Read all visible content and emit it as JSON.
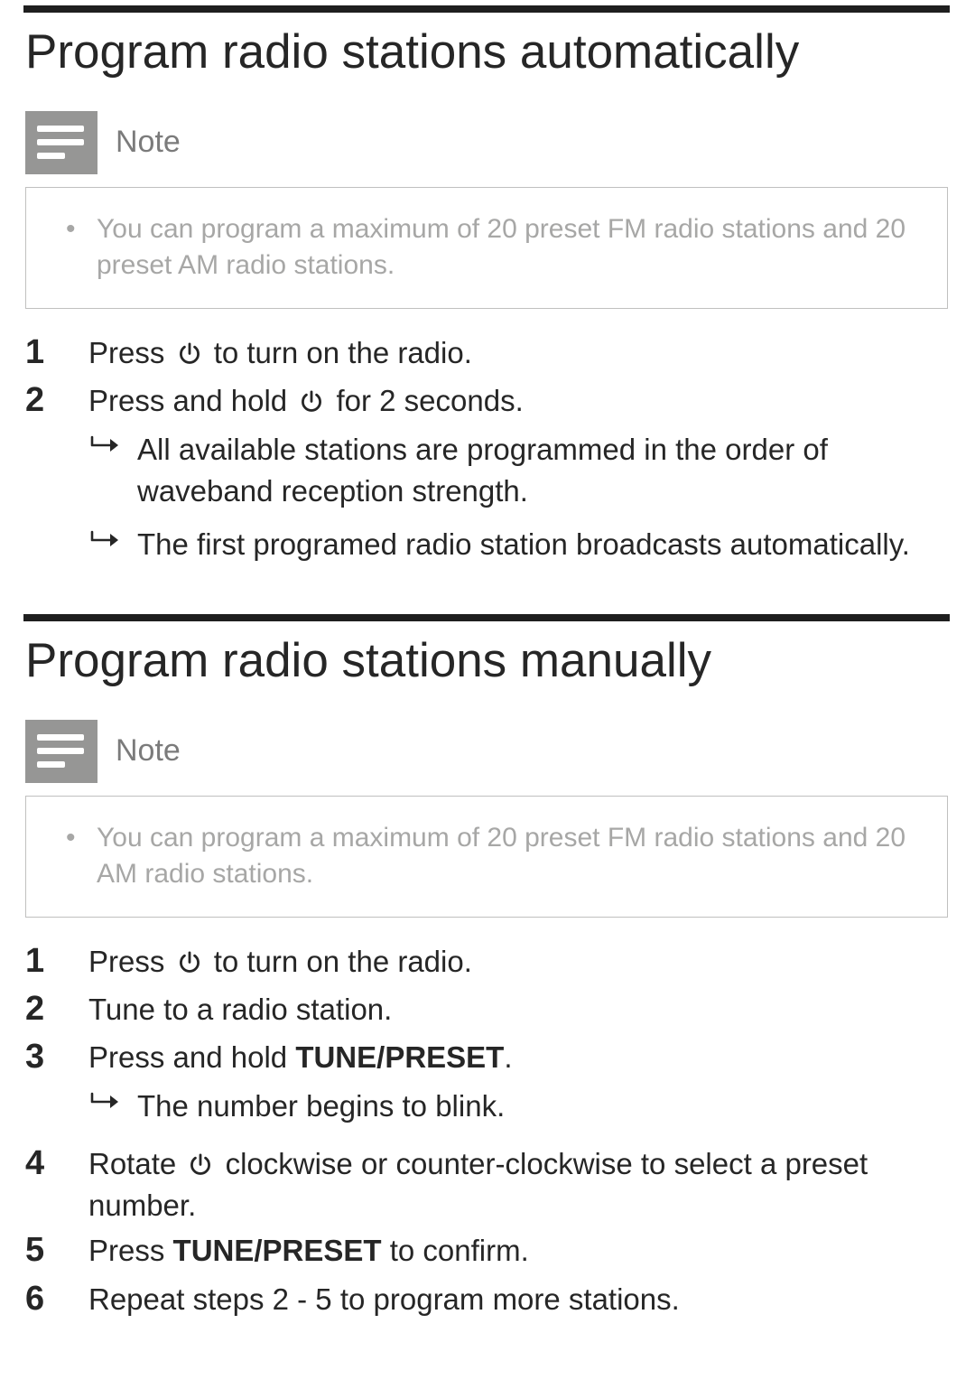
{
  "sections": [
    {
      "heading": "Program radio stations automatically",
      "note": {
        "label": "Note",
        "items": [
          "You can program a maximum of 20 preset FM radio stations and 20 preset AM radio stations."
        ]
      },
      "steps": [
        {
          "parts": [
            {
              "t": "text",
              "v": "Press "
            },
            {
              "t": "power"
            },
            {
              "t": "text",
              "v": " to turn on the radio."
            }
          ]
        },
        {
          "parts": [
            {
              "t": "text",
              "v": "Press and hold "
            },
            {
              "t": "power"
            },
            {
              "t": "text",
              "v": " for 2 seconds."
            }
          ],
          "sub": [
            "All available stations are programmed in the order of waveband reception strength.",
            "The first programed radio station broadcasts automatically."
          ]
        }
      ]
    },
    {
      "heading": "Program radio stations manually",
      "note": {
        "label": "Note",
        "items": [
          "You can program a maximum of 20 preset FM radio stations and 20 AM radio stations."
        ]
      },
      "steps": [
        {
          "parts": [
            {
              "t": "text",
              "v": "Press "
            },
            {
              "t": "power"
            },
            {
              "t": "text",
              "v": " to turn on the radio."
            }
          ]
        },
        {
          "parts": [
            {
              "t": "text",
              "v": "Tune to a radio station."
            }
          ]
        },
        {
          "parts": [
            {
              "t": "text",
              "v": "Press and hold "
            },
            {
              "t": "bold",
              "v": "TUNE/PRESET"
            },
            {
              "t": "text",
              "v": "."
            }
          ],
          "sub": [
            "The number begins to blink."
          ]
        },
        {
          "parts": [
            {
              "t": "text",
              "v": "Rotate "
            },
            {
              "t": "power"
            },
            {
              "t": "text",
              "v": " clockwise or counter-clockwise to select a preset number."
            }
          ]
        },
        {
          "parts": [
            {
              "t": "text",
              "v": "Press "
            },
            {
              "t": "bold",
              "v": "TUNE/PRESET"
            },
            {
              "t": "text",
              "v": " to confirm."
            }
          ]
        },
        {
          "parts": [
            {
              "t": "text",
              "v": "Repeat steps 2 - 5 to program more stations."
            }
          ]
        }
      ]
    }
  ]
}
